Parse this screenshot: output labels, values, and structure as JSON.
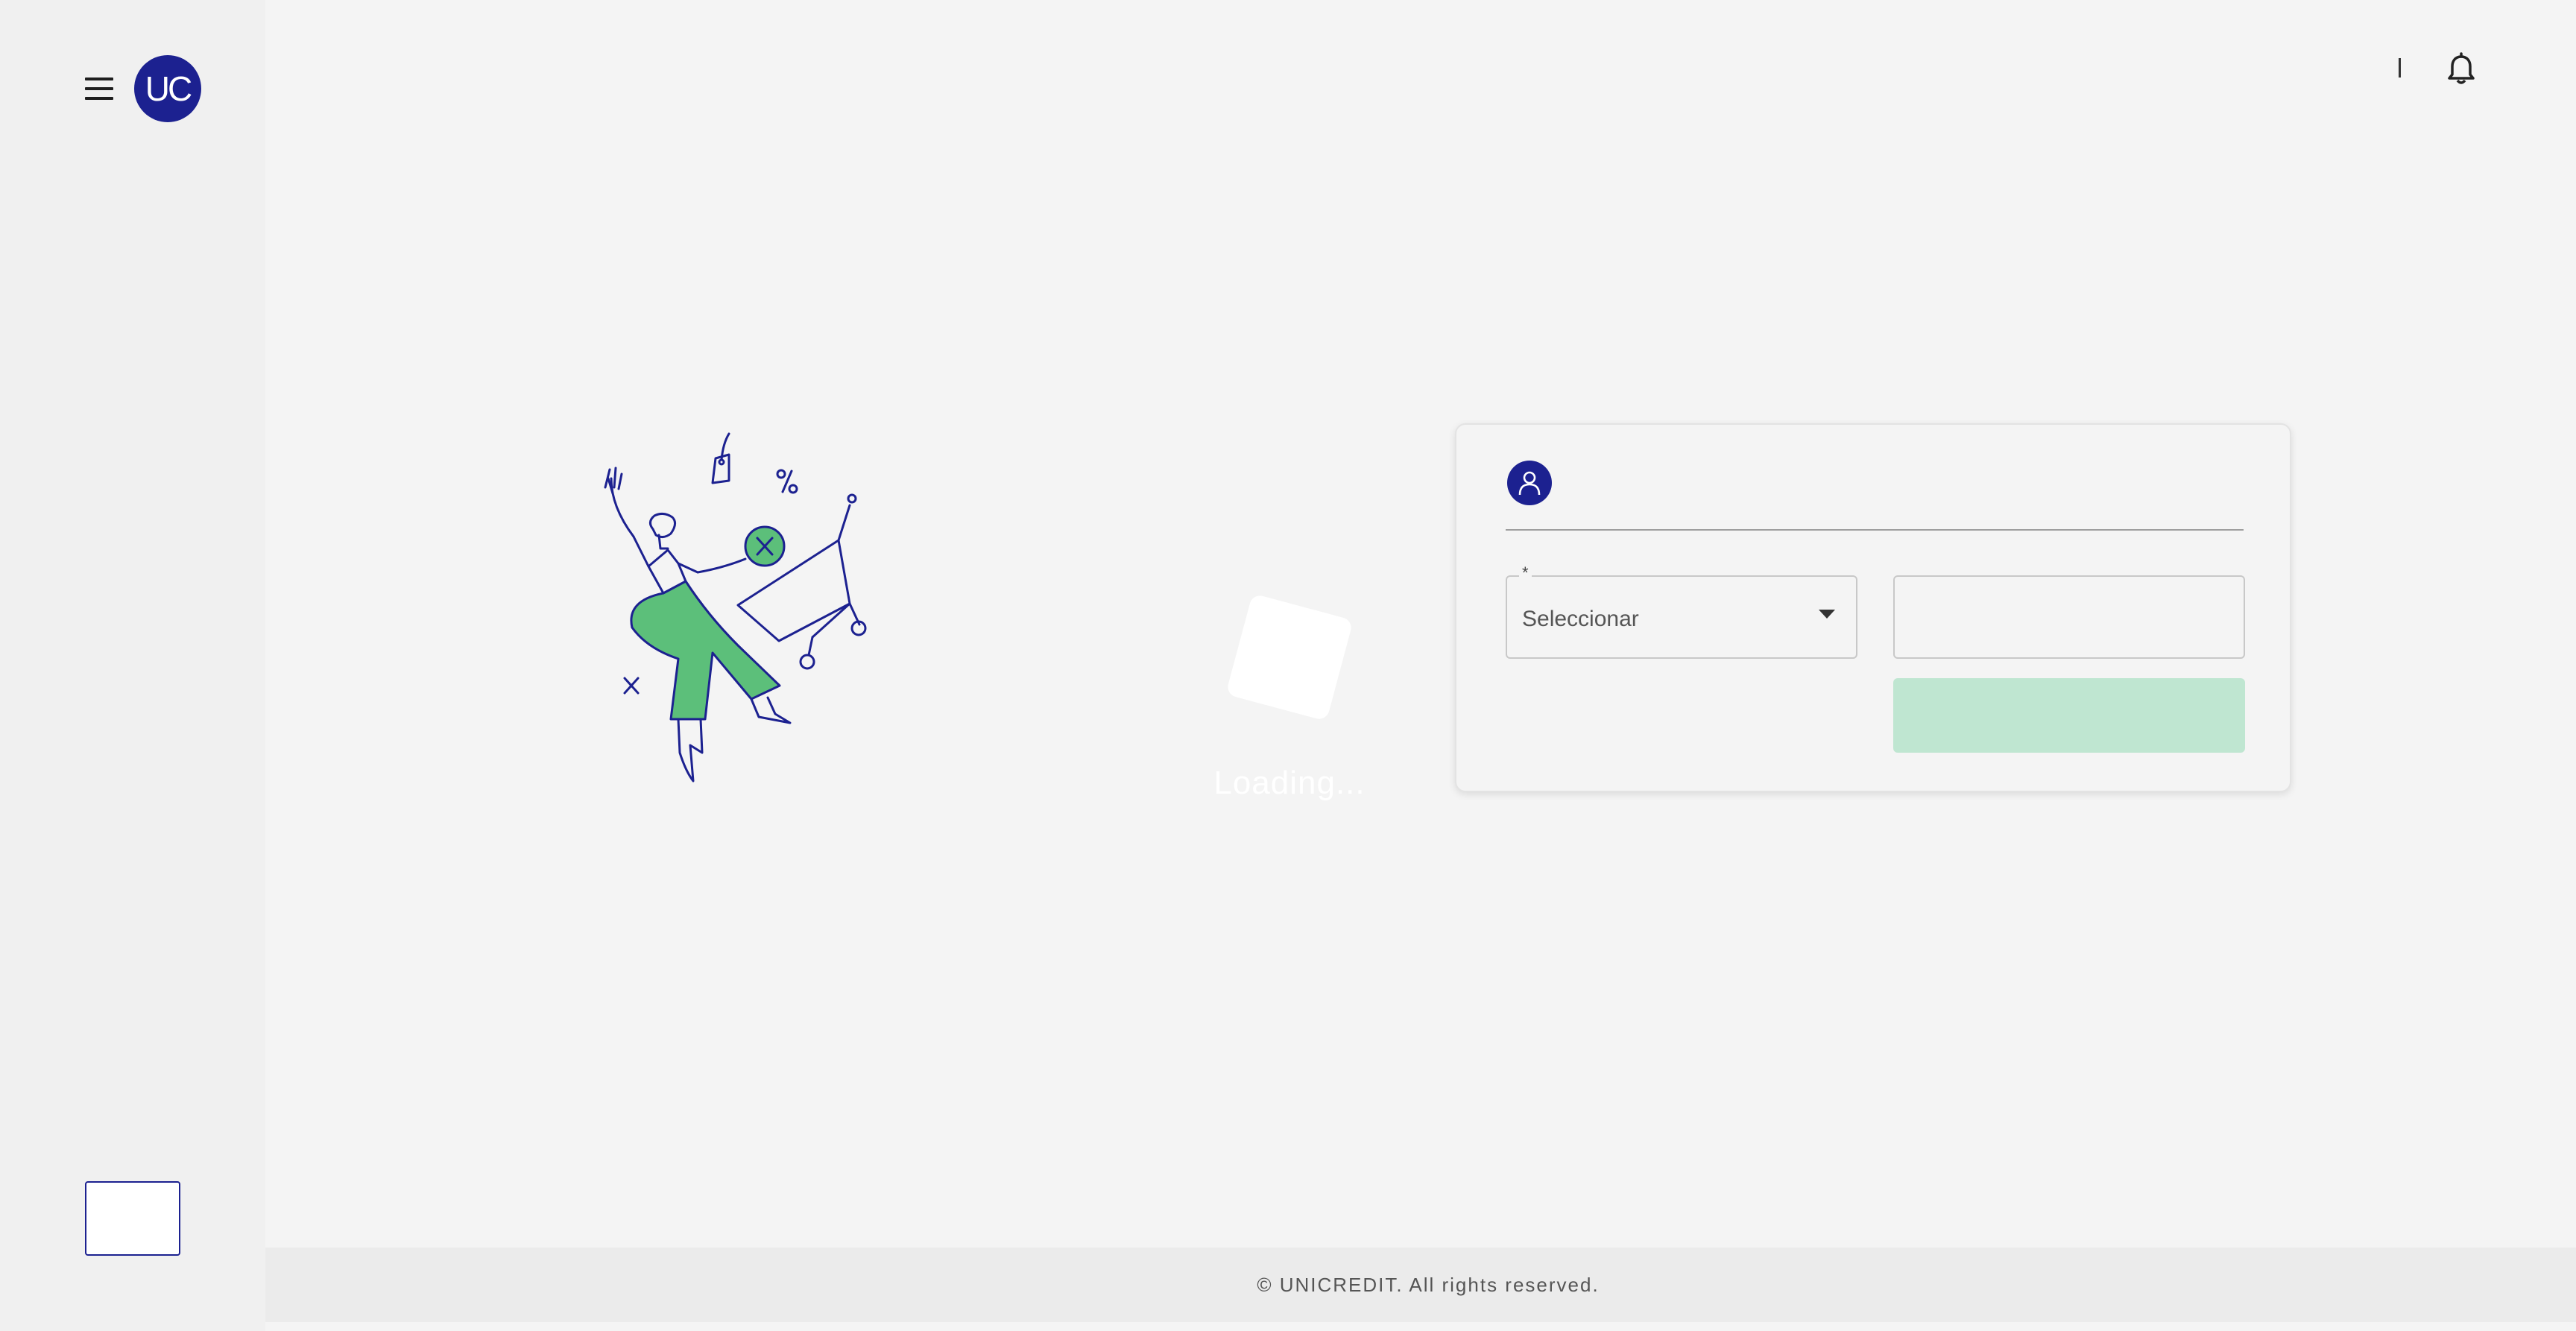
{
  "brand": {
    "logo_text": "UC",
    "primary_color": "#1c2190",
    "accent_color": "#5cbf7a"
  },
  "sidebar": {
    "menu_icon": "hamburger-menu-icon"
  },
  "header": {
    "notification_icon": "bell-icon"
  },
  "loader": {
    "text": "Loading..."
  },
  "login_card": {
    "avatar_icon": "user-icon",
    "select": {
      "required_marker": "*",
      "placeholder": "Seleccionar"
    },
    "input": {
      "value": ""
    },
    "submit_color": "#bfe6d1"
  },
  "footer": {
    "text": "© UNICREDIT. All rights reserved."
  }
}
